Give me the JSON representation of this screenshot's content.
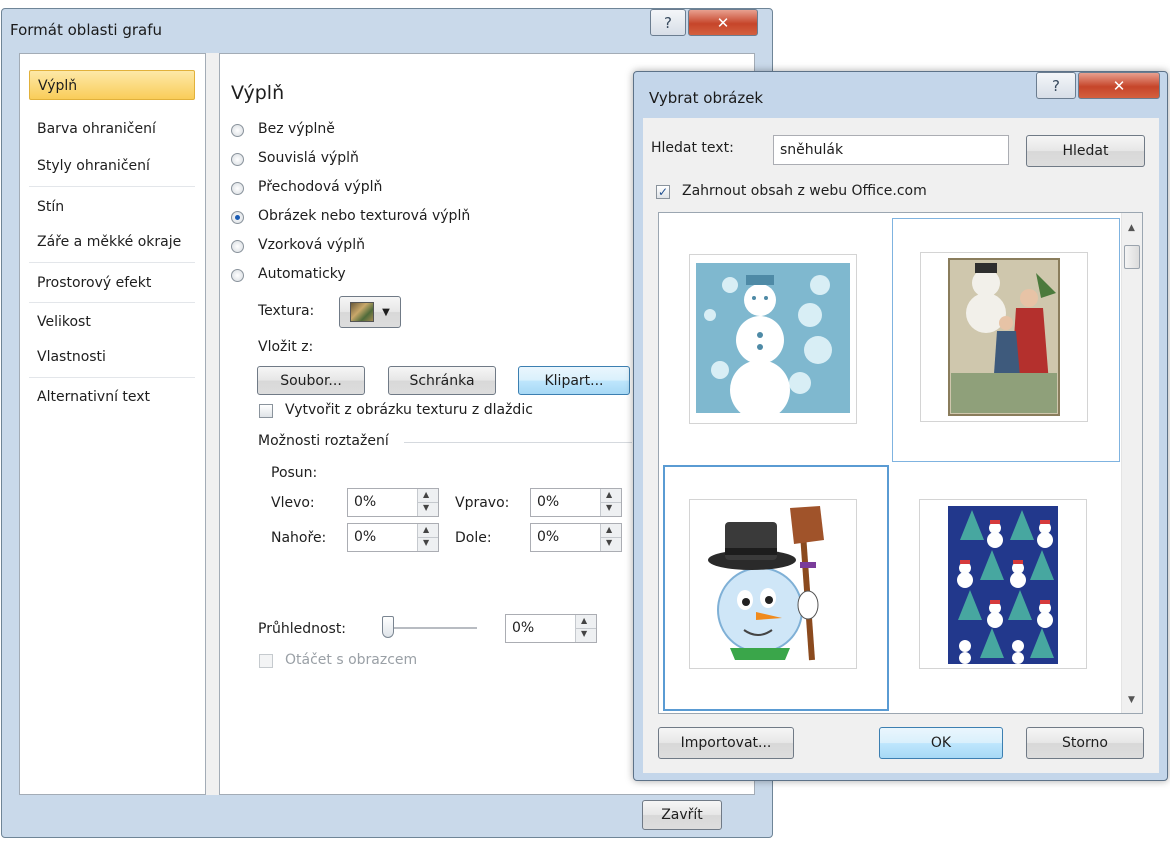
{
  "format_dialog": {
    "title": "Formát oblasti grafu",
    "close_button": "Zavřít",
    "nav_items": [
      {
        "label": "Výplň",
        "selected": true
      },
      {
        "label": "Barva ohraničení"
      },
      {
        "label": "Styly ohraničení"
      },
      {
        "label": "Stín"
      },
      {
        "label": "Záře a měkké okraje"
      },
      {
        "label": "Prostorový efekt"
      },
      {
        "label": "Velikost"
      },
      {
        "label": "Vlastnosti"
      },
      {
        "label": "Alternativní text"
      }
    ],
    "panel": {
      "heading": "Výplň",
      "fill_options": [
        {
          "label": "Bez výplně",
          "checked": false
        },
        {
          "label": "Souvislá výplň",
          "checked": false
        },
        {
          "label": "Přechodová výplň",
          "checked": false
        },
        {
          "label": "Obrázek nebo texturová výplň",
          "checked": true
        },
        {
          "label": "Vzorková výplň",
          "checked": false
        },
        {
          "label": "Automaticky",
          "checked": false
        }
      ],
      "texture_label": "Textura:",
      "insert_from_label": "Vložit z:",
      "btn_file": "Soubor...",
      "btn_clipboard": "Schránka",
      "btn_clipart": "Klipart...",
      "tile_checkbox": "Vytvořit z obrázku texturu z dlaždic",
      "stretch_options_label": "Možnosti roztažení",
      "offset_label": "Posun:",
      "left_label": "Vlevo:",
      "left_value": "0%",
      "right_label": "Vpravo:",
      "right_value": "0%",
      "top_label": "Nahoře:",
      "top_value": "0%",
      "bottom_label": "Dole:",
      "bottom_value": "0%",
      "transparency_label": "Průhlednost:",
      "transparency_value": "0%",
      "transparency_level": 0,
      "rotate_with_shape": "Otáčet s obrazcem"
    }
  },
  "picture_dialog": {
    "title": "Vybrat obrázek",
    "search_label": "Hledat text:",
    "search_value": "sněhulák",
    "search_button": "Hledat",
    "include_office": "Zahrnout obsah z webu Office.com",
    "include_office_checked": true,
    "thumbnails": [
      "snowman-blue-clipart",
      "victorian-children-snowman",
      "snowman-with-broom",
      "snowman-pattern"
    ],
    "import_button": "Importovat...",
    "ok_button": "OK",
    "cancel_button": "Storno"
  },
  "colors": {
    "selection_yellow": "#f9cd59",
    "window_frame": "#c9d9ea",
    "selection_blue": "#5a9bd3",
    "close_red": "#c6452a"
  }
}
